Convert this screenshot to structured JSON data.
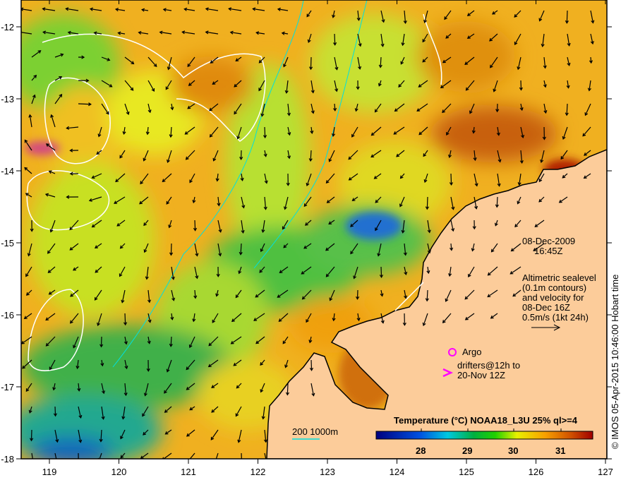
{
  "map": {
    "lon_ticks": [
      "119",
      "120",
      "121",
      "122",
      "123",
      "124",
      "125",
      "126",
      "127"
    ],
    "lat_ticks": [
      "-12",
      "-13",
      "-14",
      "-15",
      "-16",
      "-17",
      "-18"
    ],
    "date": "08-Dec-2009",
    "time": "16:45Z",
    "altimetry_note": [
      "Altimetric sealevel",
      "(0.1m contours)",
      "and velocity for",
      "08-Dec 16Z",
      "0.5m/s (1kt 24h)"
    ],
    "argo_label": "Argo",
    "drifters_label": [
      "drifters@12h to",
      "20-Nov 12Z"
    ],
    "bathymetry_label": "200  1000m",
    "credit": "© IMOS 05-Apr-2015 10:46:00 Hobart time",
    "colorbar": {
      "title": "Temperature (°C) NOAA18_L3U 25% ql>=4",
      "ticks": [
        "28",
        "29",
        "30",
        "31"
      ],
      "range": [
        27.5,
        31.8
      ]
    },
    "colors": {
      "land": "#fccc9a",
      "argo": "#ff00ff",
      "bathymetry": "#00e0e0",
      "contour": "#ffffff"
    }
  }
}
